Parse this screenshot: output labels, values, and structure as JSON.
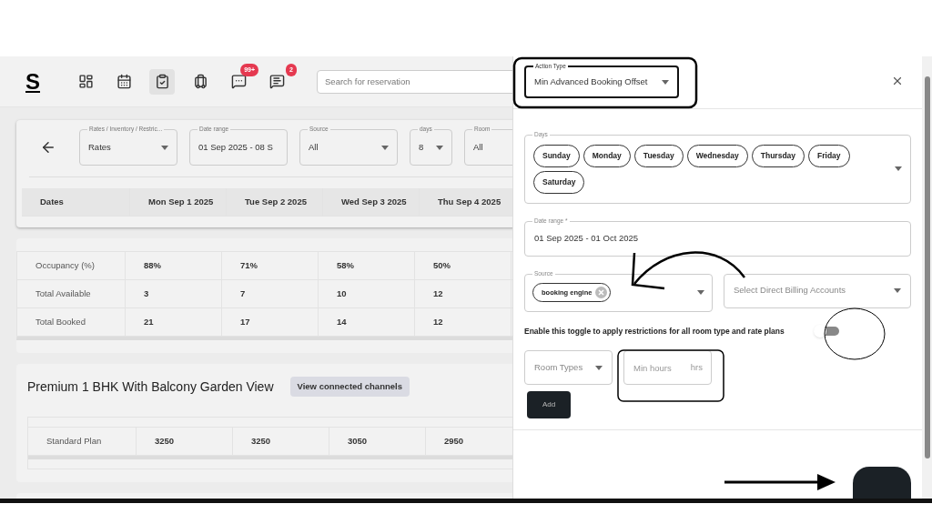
{
  "navbar": {
    "logo": "S",
    "icons": [
      {
        "kind": "dashboard",
        "selected": false
      },
      {
        "kind": "calendar",
        "selected": false
      },
      {
        "kind": "clipboard",
        "selected": true
      },
      {
        "kind": "luggage",
        "selected": false
      },
      {
        "kind": "chat",
        "selected": false,
        "badge": "99+"
      },
      {
        "kind": "message",
        "selected": false,
        "badge": "2"
      }
    ],
    "search": {
      "placeholder": "Search for reservation"
    }
  },
  "filters": [
    {
      "label": "Rates / Inventory / Restric...",
      "value": "Rates",
      "kind": "select"
    },
    {
      "label": "Date range",
      "value": "01 Sep 2025 - 08 S",
      "kind": "text"
    },
    {
      "label": "Source",
      "value": "All",
      "kind": "select"
    },
    {
      "label": "days",
      "value": "8",
      "kind": "select"
    },
    {
      "label": "Room",
      "value": "All",
      "kind": "select"
    }
  ],
  "table": {
    "columns": [
      "Dates",
      "Mon Sep 1 2025",
      "Tue Sep 2 2025",
      "Wed Sep 3 2025",
      "Thu Sep 4 2025"
    ],
    "rows": [
      [
        "Occupancy (%)",
        "88%",
        "71%",
        "58%",
        "50%"
      ],
      [
        "Total Available",
        "3",
        "7",
        "10",
        "12"
      ],
      [
        "Total Booked",
        "21",
        "17",
        "14",
        "12"
      ]
    ]
  },
  "rooms": [
    {
      "title": "Premium 1 BHK With Balcony Garden View",
      "button": "View connected channels",
      "rows": [
        [
          "Standard Plan",
          "3250",
          "3250",
          "3050",
          "2950"
        ]
      ]
    }
  ],
  "drawer": {
    "action_type": {
      "label": "Action Type",
      "value": "Min Advanced Booking Offset"
    },
    "days": {
      "label": "Days",
      "chips": [
        "Sunday",
        "Monday",
        "Tuesday",
        "Wednesday",
        "Thursday",
        "Friday",
        "Saturday"
      ]
    },
    "date_range": {
      "label": "Date range *",
      "value": "01 Sep 2025 - 01 Oct 2025"
    },
    "source": {
      "label": "Source",
      "chips": [
        "booking engine"
      ]
    },
    "billing": {
      "placeholder": "Select Direct Billing Accounts"
    },
    "toggle": {
      "label": "Enable this toggle to apply restrictions for all room type and rate plans",
      "on": false
    },
    "room_types": {
      "placeholder": "Room Types"
    },
    "min_hours": {
      "placeholder": "Min hours",
      "unit": "hrs"
    },
    "add_button": "Add"
  }
}
